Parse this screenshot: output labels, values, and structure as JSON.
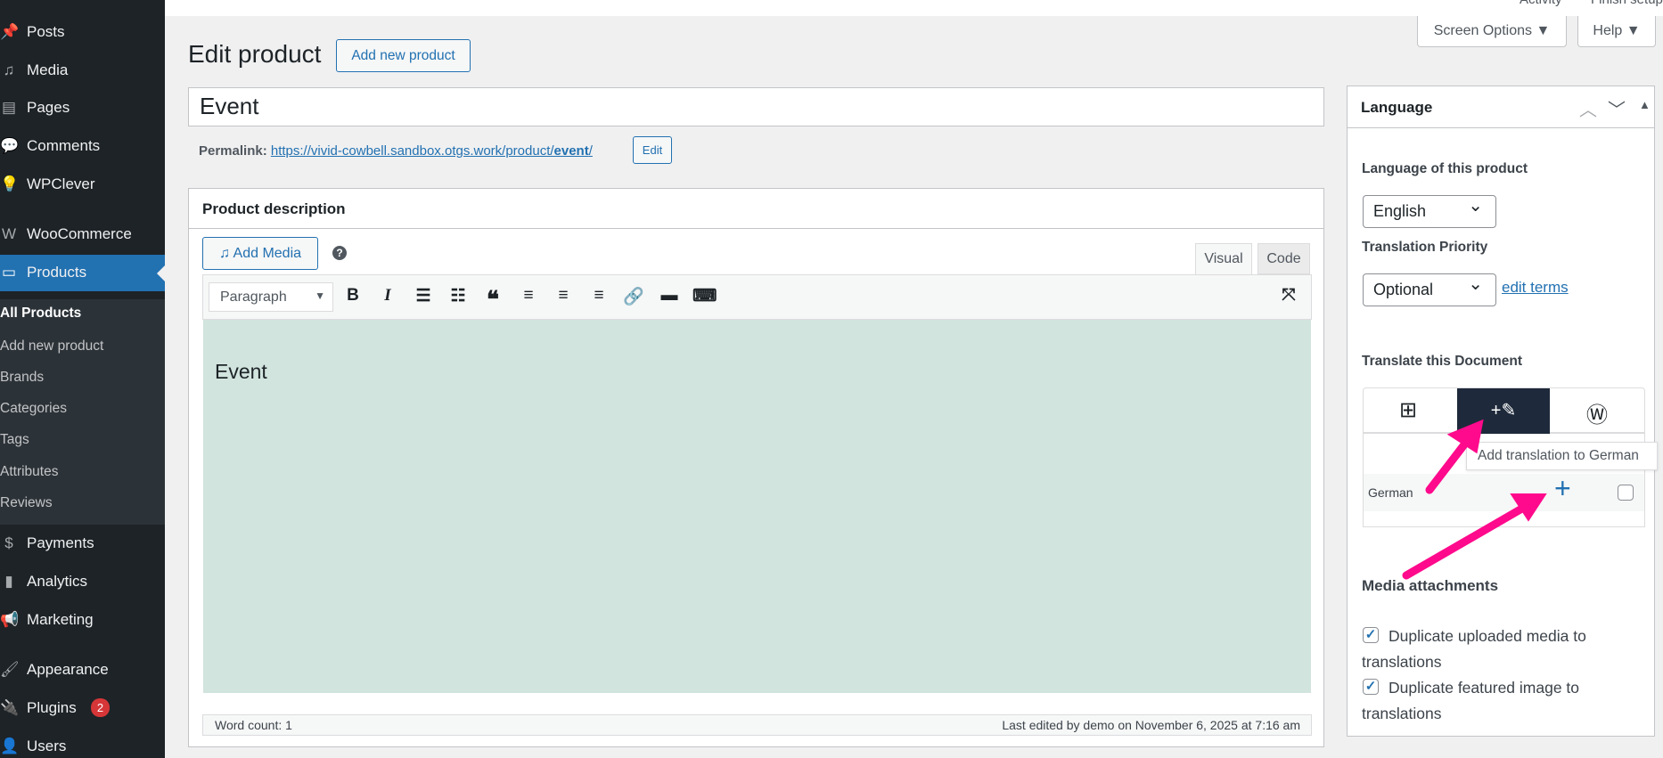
{
  "topbar": {
    "activity": "Activity",
    "finish_setup": "Finish setup",
    "screen_options": "Screen Options ▼",
    "help": "Help ▼"
  },
  "sidebar": {
    "items": [
      {
        "label": "Posts",
        "icon": "pin-icon",
        "glyph": "📌"
      },
      {
        "label": "Media",
        "icon": "media-icon",
        "glyph": "♫"
      },
      {
        "label": "Pages",
        "icon": "pages-icon",
        "glyph": "▤"
      },
      {
        "label": "Comments",
        "icon": "comment-icon",
        "glyph": "💬"
      },
      {
        "label": "WPClever",
        "icon": "bulb-icon",
        "glyph": "💡"
      },
      {
        "label": "WooCommerce",
        "icon": "woo-icon",
        "glyph": "W"
      },
      {
        "label": "Products",
        "icon": "archive-icon",
        "glyph": "▭"
      },
      {
        "label": "Payments",
        "icon": "dollar-icon",
        "glyph": "$"
      },
      {
        "label": "Analytics",
        "icon": "bar-chart-icon",
        "glyph": "▮"
      },
      {
        "label": "Marketing",
        "icon": "megaphone-icon",
        "glyph": "📢"
      },
      {
        "label": "Appearance",
        "icon": "brush-icon",
        "glyph": "🖌"
      },
      {
        "label": "Plugins",
        "icon": "plug-icon",
        "glyph": "🔌",
        "badge": "2"
      },
      {
        "label": "Users",
        "icon": "user-icon",
        "glyph": "👤"
      }
    ],
    "submenu": [
      "All Products",
      "Add new product",
      "Brands",
      "Categories",
      "Tags",
      "Attributes",
      "Reviews"
    ]
  },
  "page": {
    "title": "Edit product",
    "add_new": "Add new product",
    "product_title": "Event",
    "permalink_label": "Permalink:",
    "permalink_base": "https://vivid-cowbell.sandbox.otgs.work/product/",
    "permalink_slug": "event",
    "permalink_end": "/",
    "edit": "Edit"
  },
  "editor": {
    "heading": "Product description",
    "add_media": "Add Media",
    "help": "?",
    "tab_visual": "Visual",
    "tab_code": "Code",
    "format": "Paragraph",
    "content": "Event",
    "word_count": "Word count: 1",
    "last_edited": "Last edited by demo on November 6, 2025 at 7:16 am"
  },
  "language": {
    "heading": "Language",
    "lang_label": "Language of this product",
    "lang_value": "English",
    "priority_label": "Translation Priority",
    "priority_value": "Optional",
    "edit_terms": "edit terms",
    "translate_label": "Translate this Document",
    "tooltip": "Add translation to German",
    "row_lang": "German",
    "media_heading": "Media attachments",
    "opt1": "Duplicate uploaded media to translations",
    "opt2": "Duplicate featured image to translations"
  },
  "colors": {
    "accent": "#2271b1",
    "sidebar": "#1d2327",
    "annotation": "#ff0a8c",
    "editor_bg": "#d2e4de"
  }
}
